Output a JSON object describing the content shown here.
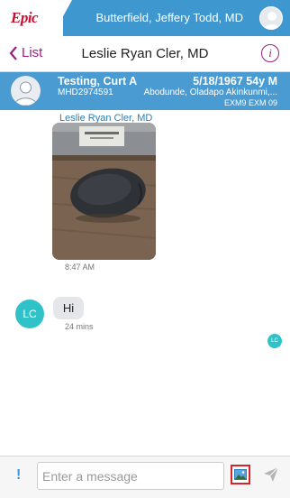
{
  "app": {
    "logo_text": "Epic",
    "logged_in_user": "Butterfield, Jeffery Todd, MD"
  },
  "nav": {
    "back_label": "List",
    "title": "Leslie Ryan Cler, MD"
  },
  "patient": {
    "name": "Testing, Curt A",
    "dob_age_sex": "5/18/1967 54y M",
    "mrn": "MHD2974591",
    "providers": "Abodunde, Oladapo Akinkunmi,...",
    "department": "EXM9 EXM 09"
  },
  "messages": [
    {
      "sender": "Leslie Ryan Cler, MD",
      "type": "image",
      "image_desc": "computer mouse photo",
      "time": "8:47 AM"
    },
    {
      "sender_initials": "LC",
      "type": "text",
      "text": "Hi",
      "time": "24 mins"
    }
  ],
  "read_receipt_initials": "LC",
  "composer": {
    "placeholder": "Enter a message"
  },
  "colors": {
    "brand_blue": "#3f97d0",
    "accent_magenta": "#9c1f7e",
    "avatar_teal": "#2fc3c9",
    "highlight_red": "#d8232a"
  }
}
